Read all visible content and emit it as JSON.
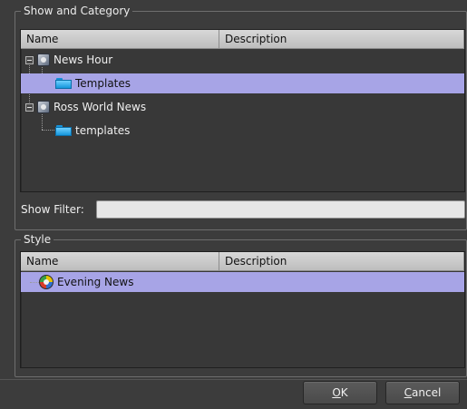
{
  "show_category": {
    "legend": "Show and Category",
    "columns": [
      "Name",
      "Description"
    ],
    "rows": [
      {
        "label": "News Hour",
        "level": 0,
        "type": "show",
        "selected": false
      },
      {
        "label": "Templates",
        "level": 1,
        "type": "folder",
        "selected": true
      },
      {
        "label": "Ross World News",
        "level": 0,
        "type": "show",
        "selected": false
      },
      {
        "label": "templates",
        "level": 1,
        "type": "folder",
        "selected": false
      }
    ],
    "filter_label": "Show Filter:",
    "filter_value": ""
  },
  "style": {
    "legend": "Style",
    "columns": [
      "Name",
      "Description"
    ],
    "rows": [
      {
        "label": "Evening News",
        "type": "style",
        "selected": true
      }
    ]
  },
  "buttons": {
    "ok_mnemonic": "O",
    "ok_rest": "K",
    "cancel_mnemonic": "C",
    "cancel_rest": "ancel"
  },
  "colors": {
    "background": "#3c3c3c",
    "selection": "#a7a4e6",
    "header": "#c8c8c8"
  }
}
